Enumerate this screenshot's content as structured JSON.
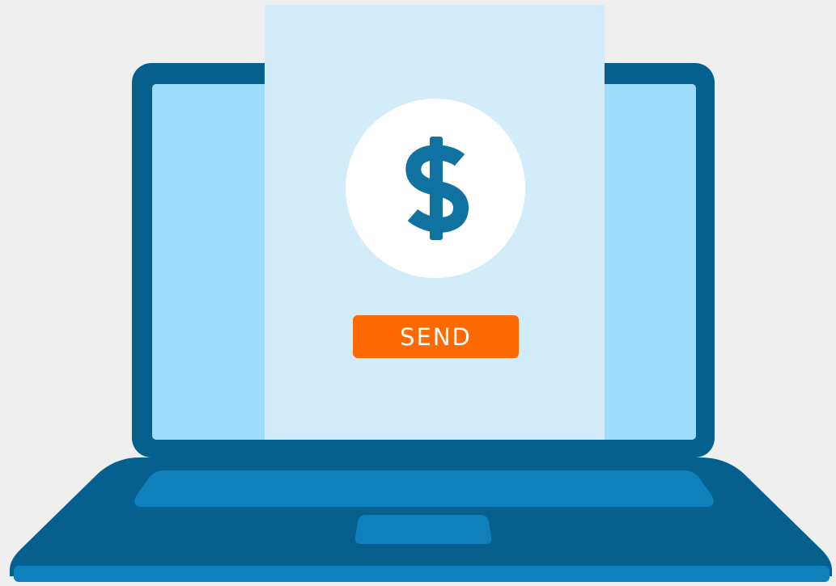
{
  "illustration": {
    "subject": "laptop-with-payment-document",
    "icons": {
      "laptop": "laptop-icon",
      "document": "document-icon",
      "dollar": "dollar-icon"
    },
    "dollar_symbol": "$"
  },
  "actions": {
    "send_label": "SEND"
  },
  "colors": {
    "background": "#efefef",
    "laptop_frame": "#05608d",
    "laptop_screen": "#9fdcfb",
    "document": "#d2ecfa",
    "coin": "#ffffff",
    "dollar": "#0f72a0",
    "send_button": "#ff6a00",
    "keyboard_panel": "#0f80bc"
  }
}
